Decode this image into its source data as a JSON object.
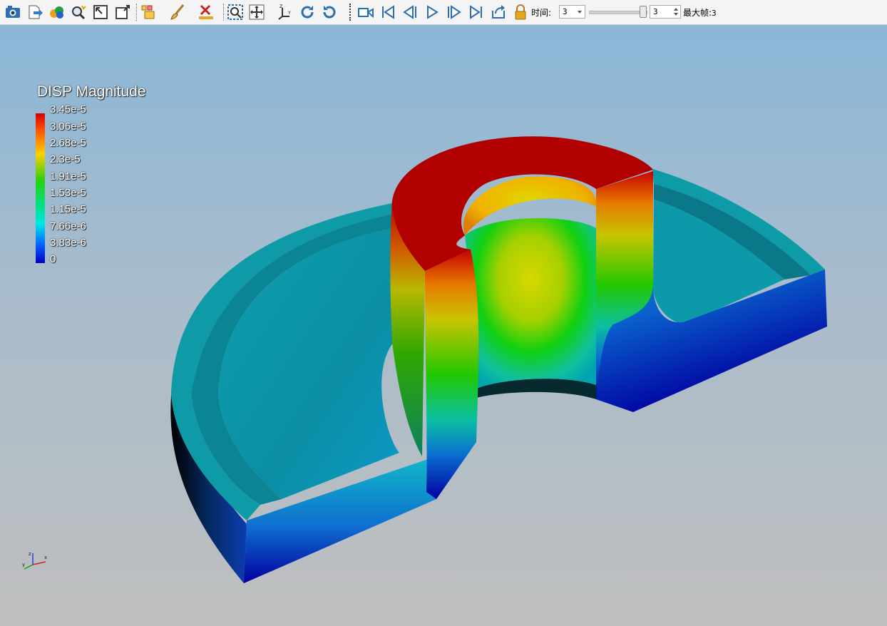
{
  "toolbar": {
    "icons": [
      "camera-icon",
      "export-icon",
      "color-map-icon",
      "magnify-icon",
      "fit-view-icon",
      "zoom-box-icon",
      "layers-icon",
      "brush-icon",
      "delete-ruler-icon",
      "zoom-selection-icon",
      "move-icon",
      "axes-orient-icon",
      "rotate-cw-icon",
      "rotate-ccw-icon",
      "camera-record-icon",
      "first-frame-icon",
      "prev-frame-icon",
      "play-icon",
      "next-frame-icon",
      "last-frame-icon",
      "loop-icon",
      "lock-icon"
    ],
    "time_label": "时间:",
    "time_value": "3",
    "time_options_selected": "3",
    "slider_value": 1.0,
    "spin_value": "3",
    "max_frame_label": "最大帧:",
    "max_frame_value": "3"
  },
  "legend": {
    "title": "DISP Magnitude",
    "ticks": [
      "3.45e-5",
      "3.06e-5",
      "2.68e-5",
      "2.3e-5",
      "1.91e-5",
      "1.53e-5",
      "1.15e-5",
      "7.66e-6",
      "3.83e-6",
      "0"
    ],
    "colors": [
      "#d40000",
      "#ff5a00",
      "#ffd000",
      "#28d010",
      "#00e28a",
      "#00e6e6",
      "#0060ff",
      "#0000c0"
    ]
  },
  "axes": {
    "x": "x",
    "y": "y",
    "z": "z"
  }
}
